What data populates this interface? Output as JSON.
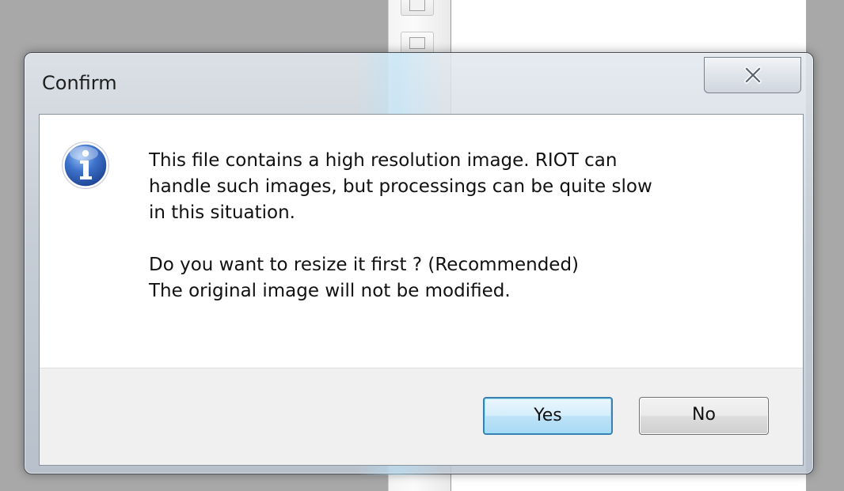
{
  "dialog": {
    "title": "Confirm",
    "close_glyph": "close-icon",
    "icon": "info-icon",
    "message_lines": [
      "This file contains a high resolution image. RIOT can",
      "handle such images, but processings can be quite slow",
      "in this situation.",
      "Do you want to resize it first ? (Recommended)",
      "The original image will not be modified."
    ],
    "buttons": {
      "yes_label": "Yes",
      "no_label": "No"
    }
  },
  "colors": {
    "accent": "#3c7fb1",
    "info_icon_blue": "#2f5fb8"
  }
}
